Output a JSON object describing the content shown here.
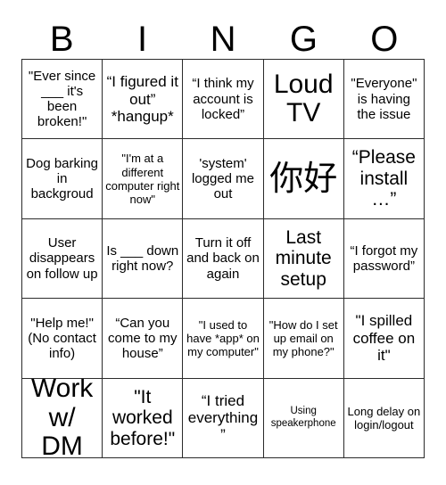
{
  "card": {
    "title": "BINGO",
    "header_letters": [
      "B",
      "I",
      "N",
      "G",
      "O"
    ],
    "grid_size": "5x5",
    "border_color": "#2b2b2b",
    "background_color": "#ffffff",
    "text_color": "#000000"
  },
  "squares": [
    {
      "row": 1,
      "col": 1,
      "column_letter": "B",
      "size": "fs-md",
      "text": "\"Ever since ___ it's been broken!\""
    },
    {
      "row": 1,
      "col": 2,
      "column_letter": "I",
      "size": "fs-lg",
      "text": "“I figured it out” *hangup*"
    },
    {
      "row": 1,
      "col": 3,
      "column_letter": "N",
      "size": "fs-md",
      "text": "“I think my account is locked”"
    },
    {
      "row": 1,
      "col": 4,
      "column_letter": "G",
      "size": "fs-xxl",
      "text": "Loud TV"
    },
    {
      "row": 1,
      "col": 5,
      "column_letter": "O",
      "size": "fs-md",
      "text": "\"Everyone\" is having the issue"
    },
    {
      "row": 2,
      "col": 1,
      "column_letter": "B",
      "size": "fs-md",
      "text": "Dog barking in backgroud"
    },
    {
      "row": 2,
      "col": 2,
      "column_letter": "I",
      "size": "fs-sm",
      "text": "\"I'm at a different computer right now\""
    },
    {
      "row": 2,
      "col": 3,
      "column_letter": "N",
      "size": "fs-md",
      "text": "'system' logged me out"
    },
    {
      "row": 2,
      "col": 4,
      "column_letter": "G",
      "size": "fs-cjk",
      "text": "你好"
    },
    {
      "row": 2,
      "col": 5,
      "column_letter": "O",
      "size": "fs-xl",
      "text": "“Please install …”"
    },
    {
      "row": 3,
      "col": 1,
      "column_letter": "B",
      "size": "fs-md",
      "text": "User disappears on follow up"
    },
    {
      "row": 3,
      "col": 2,
      "column_letter": "I",
      "size": "fs-md",
      "text": "Is ___ down right now?"
    },
    {
      "row": 3,
      "col": 3,
      "column_letter": "N",
      "size": "fs-md",
      "text": "Turn it off and back on again"
    },
    {
      "row": 3,
      "col": 4,
      "column_letter": "G",
      "size": "fs-xl",
      "text": "Last minute setup"
    },
    {
      "row": 3,
      "col": 5,
      "column_letter": "O",
      "size": "fs-md",
      "text": "“I forgot my password”"
    },
    {
      "row": 4,
      "col": 1,
      "column_letter": "B",
      "size": "fs-md",
      "text": "\"Help me!\" (No contact info)"
    },
    {
      "row": 4,
      "col": 2,
      "column_letter": "I",
      "size": "fs-md",
      "text": "“Can you come to my house”"
    },
    {
      "row": 4,
      "col": 3,
      "column_letter": "N",
      "size": "fs-sm",
      "text": "\"I used to have *app* on my computer\""
    },
    {
      "row": 4,
      "col": 4,
      "column_letter": "G",
      "size": "fs-sm",
      "text": "\"How do I set up email on my phone?\""
    },
    {
      "row": 4,
      "col": 5,
      "column_letter": "O",
      "size": "fs-lg",
      "text": "\"I spilled coffee on it\""
    },
    {
      "row": 5,
      "col": 1,
      "column_letter": "B",
      "size": "fs-xxl",
      "text": "Work w/ DM"
    },
    {
      "row": 5,
      "col": 2,
      "column_letter": "I",
      "size": "fs-xl",
      "text": "\"It worked before!\""
    },
    {
      "row": 5,
      "col": 3,
      "column_letter": "N",
      "size": "fs-lg",
      "text": "“I tried everything”"
    },
    {
      "row": 5,
      "col": 4,
      "column_letter": "G",
      "size": "fs-xs",
      "text": "Using speakerphone"
    },
    {
      "row": 5,
      "col": 5,
      "column_letter": "O",
      "size": "fs-sm",
      "text": "Long delay on login/logout"
    }
  ]
}
